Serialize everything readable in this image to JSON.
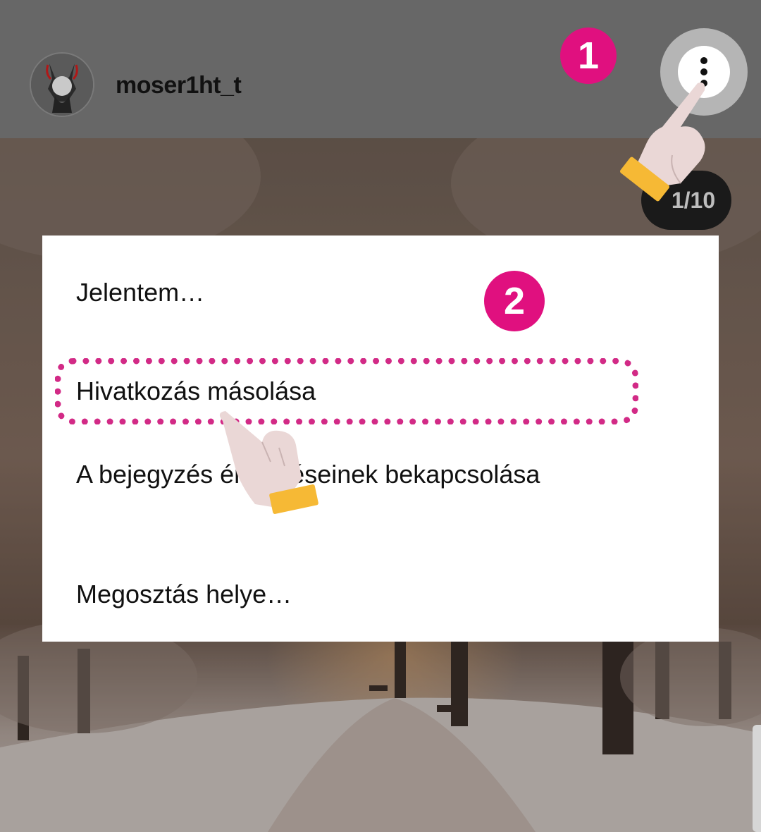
{
  "header": {
    "username": "moser1ht_t",
    "more_icon": "more-vertical-icon"
  },
  "annotations": {
    "step1": "1",
    "step2": "2"
  },
  "counter": "1/10",
  "menu": {
    "items": [
      "Jelentem…",
      "Hivatkozás másolása",
      "A bejegyzés értesítéseinek bekapcsolása",
      "Megosztás helye…"
    ]
  },
  "colors": {
    "header_bg": "#676767",
    "accent_magenta": "#e0107f",
    "highlight_border": "#d22a86",
    "menu_bg": "#ffffff",
    "counter_bg": "#1a1a1a"
  }
}
